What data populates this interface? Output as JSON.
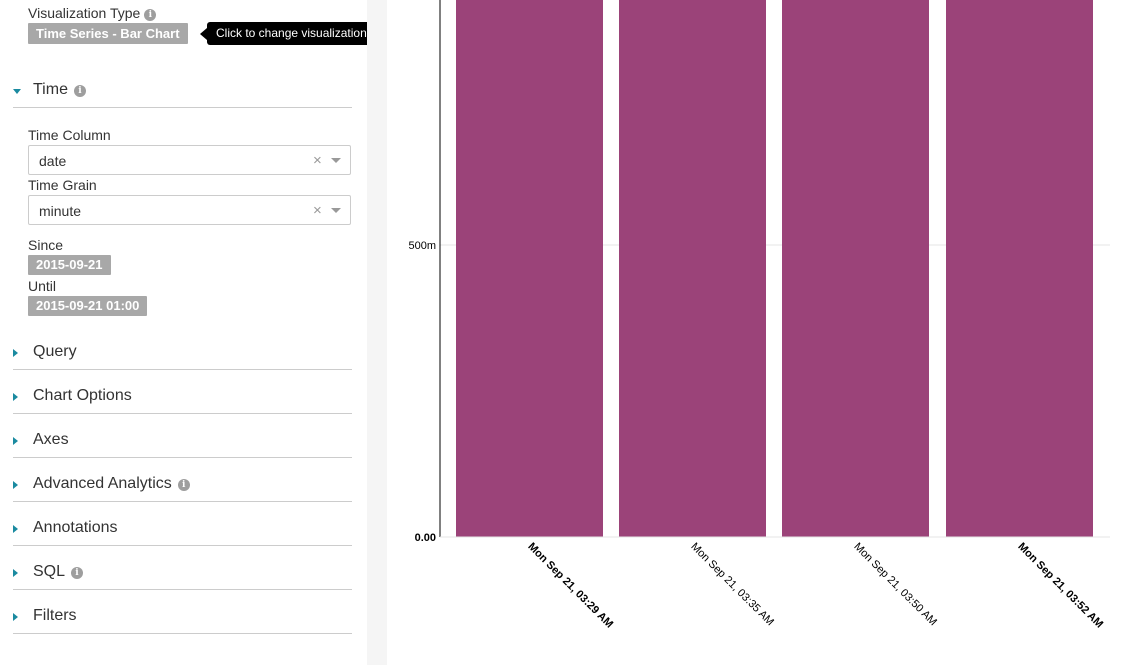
{
  "viz": {
    "label": "Visualization Type",
    "value": "Time Series - Bar Chart",
    "tooltip": "Click to change visualization type"
  },
  "sections": {
    "time": "Time",
    "query": "Query",
    "chart_options": "Chart Options",
    "axes": "Axes",
    "advanced_analytics": "Advanced Analytics",
    "annotations": "Annotations",
    "sql": "SQL",
    "filters": "Filters"
  },
  "time": {
    "time_column_label": "Time Column",
    "time_column_value": "date",
    "time_grain_label": "Time Grain",
    "time_grain_value": "minute",
    "since_label": "Since",
    "since_value": "2015-09-21",
    "until_label": "Until",
    "until_value": "2015-09-21 01:00"
  },
  "icons": {
    "info": "info-icon",
    "clear": "×"
  },
  "colors": {
    "bar": "#9b4379",
    "accent": "#1a8aa0",
    "pill": "#a8a8a8"
  },
  "chart_data": {
    "type": "bar",
    "categories": [
      "Mon Sep 21, 03:29 AM",
      "Mon Sep 21, 03:35 AM",
      "Mon Sep 21, 03:50 AM",
      "Mon Sep 21, 03:52 AM"
    ],
    "values": [
      1,
      1,
      1,
      1
    ],
    "y_ticks": [
      {
        "value": 0,
        "label": "0.00"
      },
      {
        "value": 0.5,
        "label": "500m"
      }
    ],
    "bold_x_labels": [
      0,
      3
    ],
    "bold_y_labels": [
      0
    ],
    "ylim": [
      0,
      1
    ],
    "xlabel": "",
    "ylabel": "",
    "grid": true
  }
}
